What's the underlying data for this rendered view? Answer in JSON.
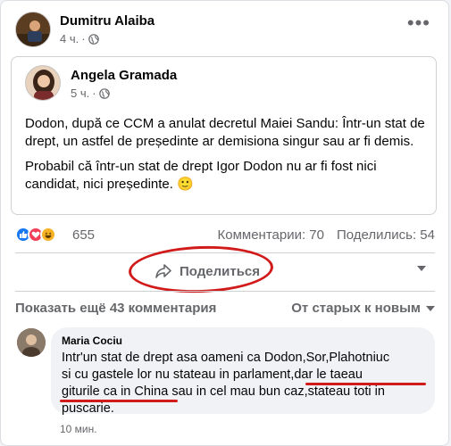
{
  "post": {
    "author": "Dumitru Alaiba",
    "time": "4 ч.",
    "privacy_icon": "globe-icon",
    "options_icon": "more-options-icon"
  },
  "shared_post": {
    "author": "Angela Gramada",
    "time": "5 ч.",
    "privacy_icon": "globe-icon",
    "paragraphs": [
      "Dodon, după ce CCM a anulat decretul Maiei Sandu: Într-un stat de drept, un astfel de președinte ar demisiona singur sau ar fi demis.",
      "Probabil că într-un stat de drept Igor Dodon nu ar fi fost nici candidat, nici președinte. 🙂"
    ]
  },
  "stats": {
    "reactions_count": "655",
    "comments": "Комментарии: 70",
    "shares": "Поделились: 54",
    "reaction_icons": [
      "like-icon",
      "love-icon",
      "haha-icon"
    ]
  },
  "actions": {
    "share_label": "Поделиться",
    "share_icon": "share-arrow-icon"
  },
  "comments_bar": {
    "show_more": "Показать ещё 43 комментария",
    "sort_label": "От старых к новым"
  },
  "comment": {
    "author": "Maria Cociu",
    "text_lines": [
      "Intr'un stat de drept asa oameni ca Dodon,Sor,Plahotniuc",
      "si cu gastele lor nu stateau in parlament,dar le taeau",
      "giturile ca in China sau in cel mau bun caz,stateau toti in",
      "puscarie."
    ],
    "time": "10 мин."
  },
  "colors": {
    "annotation_red": "#d11a1a",
    "like_blue": "#1877f2",
    "secondary_text": "#65676b"
  }
}
